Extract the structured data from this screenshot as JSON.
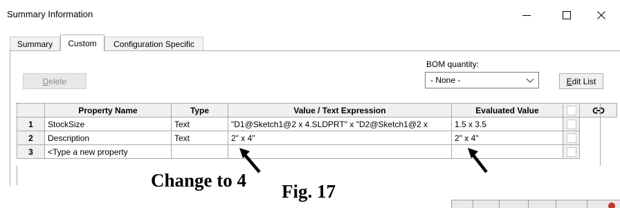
{
  "window": {
    "title": "Summary Information",
    "minimize_icon": "minimize-icon",
    "maximize_icon": "maximize-icon",
    "close_icon": "close-icon"
  },
  "tabs": [
    {
      "label": "Summary",
      "active": false
    },
    {
      "label": "Custom",
      "active": true
    },
    {
      "label": "Configuration Specific",
      "active": false
    }
  ],
  "toolbar": {
    "delete_label": "Delete",
    "delete_mnemonic": "D",
    "delete_rest": "elete",
    "bom_label": "BOM quantity:",
    "bom_value": "- None -",
    "edit_list_label": "Edit List",
    "edit_list_mnemonic": "E",
    "edit_list_rest": "dit List"
  },
  "table": {
    "headers": [
      "Property Name",
      "Type",
      "Value / Text Expression",
      "Evaluated Value"
    ],
    "link_icon": "link-icon",
    "rows": [
      {
        "num": "1",
        "name": "StockSize",
        "type": "Text",
        "value": "\"D1@Sketch1@2 x 4.SLDPRT\" x \"D2@Sketch1@2 x",
        "evaluated": "1.5 x 3.5"
      },
      {
        "num": "2",
        "name": "Description",
        "type": "Text",
        "value": "2\" x 4\"",
        "evaluated": "2\" x 4\""
      },
      {
        "num": "3",
        "name": "<Type a new property",
        "type": "",
        "value": "",
        "evaluated": ""
      }
    ]
  },
  "annotations": {
    "change_caption": "Change to 4",
    "figure_caption": "Fig. 17"
  },
  "colors": {
    "disabled_text": "#8c8c8c",
    "grid_line": "#a8a8a8",
    "header_bg": "#f0f0f0"
  }
}
